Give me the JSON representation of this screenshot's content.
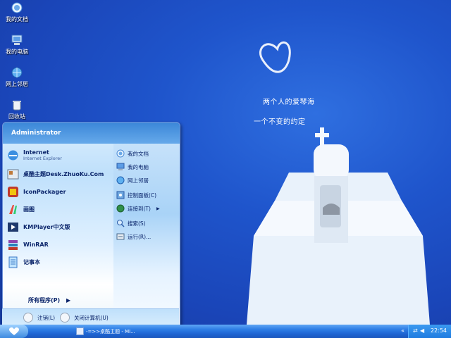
{
  "desktop": {
    "icons": [
      {
        "label": "我的文档",
        "icon": "my-documents-icon"
      },
      {
        "label": "我的电脑",
        "icon": "my-computer-icon"
      },
      {
        "label": "网上邻居",
        "icon": "network-places-icon"
      },
      {
        "label": "回收站",
        "icon": "recycle-bin-icon"
      }
    ],
    "wallpaper": {
      "line1": "两个人的爱琴海",
      "line2": "一个不变的约定"
    }
  },
  "start_menu": {
    "user": "Administrator",
    "programs": [
      {
        "label": "Internet",
        "sub": "Internet Explorer",
        "icon": "internet-explorer-icon"
      },
      {
        "label": "桌酷主题Desk.ZhuoKu.Com",
        "icon": "zhuoku-theme-icon"
      },
      {
        "label": "IconPackager",
        "icon": "iconpackager-icon"
      },
      {
        "label": "画图",
        "icon": "paint-icon"
      },
      {
        "label": "KMPlayer中文版",
        "icon": "kmplayer-icon"
      },
      {
        "label": "WinRAR",
        "icon": "winrar-icon"
      },
      {
        "label": "记事本",
        "icon": "notepad-icon"
      }
    ],
    "all_programs": "所有程序(P)",
    "places": [
      {
        "label": "我的文档",
        "icon": "my-documents-icon"
      },
      {
        "label": "我的电脑",
        "icon": "my-computer-icon"
      },
      {
        "label": "网上邻居",
        "icon": "network-places-icon"
      },
      {
        "label": "控制面板(C)",
        "icon": "control-panel-icon"
      },
      {
        "label": "连接到(T)",
        "icon": "connect-to-icon"
      },
      {
        "label": "搜索(S)",
        "icon": "search-icon"
      },
      {
        "label": "运行(R)...",
        "icon": "run-icon"
      }
    ],
    "logoff": "注销(L)",
    "shutdown": "关闭计算机(U)"
  },
  "taskbar": {
    "task_label": "-=>>桌酷主题 - Mi...",
    "clock": "22:54"
  }
}
